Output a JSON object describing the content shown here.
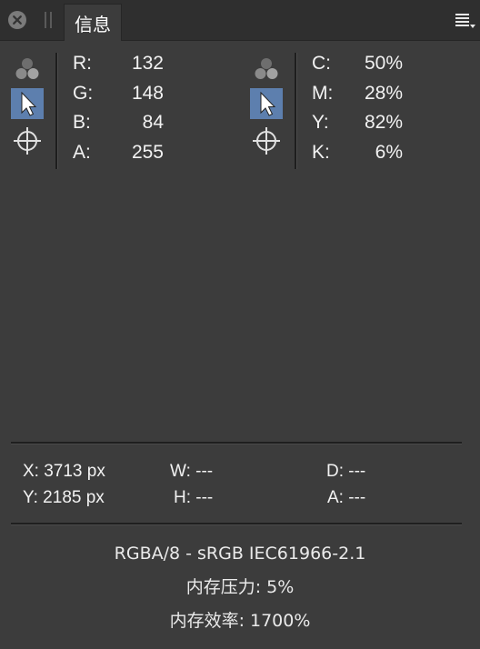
{
  "window": {
    "tab_label": "信息"
  },
  "left_readout": {
    "rows": [
      {
        "label": "R:",
        "value": "132"
      },
      {
        "label": "G:",
        "value": "148"
      },
      {
        "label": "B:",
        "value": "84"
      },
      {
        "label": "A:",
        "value": "255"
      }
    ]
  },
  "right_readout": {
    "rows": [
      {
        "label": "C:",
        "value": "50%"
      },
      {
        "label": "M:",
        "value": "28%"
      },
      {
        "label": "Y:",
        "value": "82%"
      },
      {
        "label": "K:",
        "value": "6%"
      }
    ]
  },
  "tools": {
    "icons": [
      "color-channels-icon",
      "pointer-icon",
      "crosshair-target-icon"
    ],
    "selected": "pointer-icon"
  },
  "coordinates": {
    "x": "X: 3713 px",
    "y": "Y: 2185 px",
    "w": "W: ---",
    "h": "H: ---",
    "d": "D: ---",
    "a": "A: ---"
  },
  "footer": {
    "color_format": "RGBA/8 - sRGB IEC61966-2.1",
    "memory_pressure": "内存压力: 5%",
    "memory_efficiency": "内存效率: 1700%"
  },
  "colors": {
    "panel_bg": "#3c3c3c",
    "titlebar_bg": "#2f2f2f",
    "selected_tool": "#5d7fae",
    "text": "#f2f2f2"
  }
}
